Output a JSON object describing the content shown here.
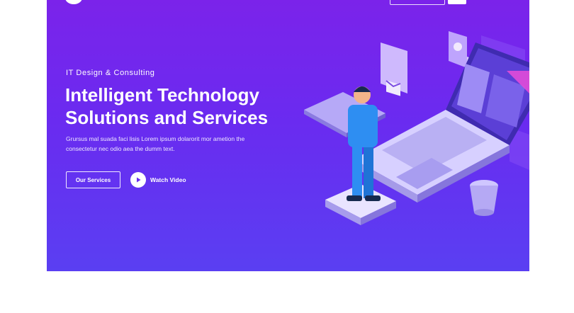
{
  "hero": {
    "eyebrow": "IT Design & Consulting",
    "title_line1": "Intelligent Technology",
    "title_line2": "Solutions and Services",
    "description_line1": "Grursus mal suada faci lisis Lorem ipsum dolarorit mor ametion the",
    "description_line2": "consectetur nec odio aea the dumm text.",
    "primary_button": "Our Services",
    "video_button": "Watch Video"
  },
  "icons": {
    "logo": "logo-mark",
    "play": "play-icon",
    "illustration": "isometric-laptop-person"
  },
  "colors": {
    "hero_gradient_top": "#7b23ea",
    "hero_gradient_bottom": "#5a3ff2",
    "text": "#ffffff",
    "illustration_accent": "#e14bd8",
    "person": "#2e8ef2"
  }
}
